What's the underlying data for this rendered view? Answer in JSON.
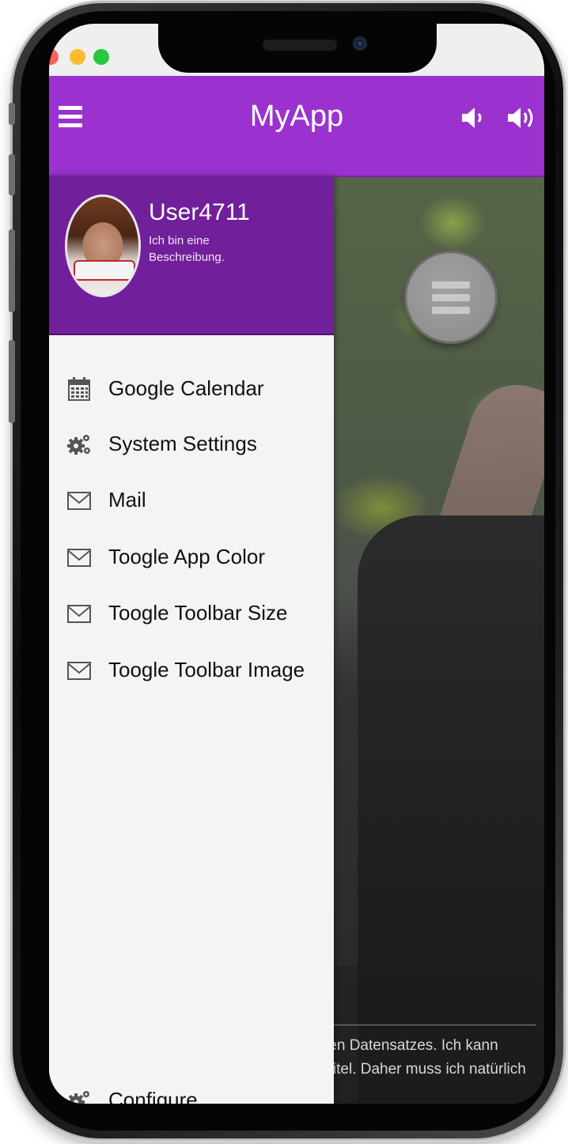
{
  "window_controls": [
    "close",
    "minimize",
    "zoom"
  ],
  "toolbar": {
    "title": "MyApp",
    "menu_icon": "hamburger-icon",
    "actions": [
      {
        "icon": "volume-down-icon"
      },
      {
        "icon": "volume-up-icon"
      }
    ],
    "color": "#9b32cf"
  },
  "drawer": {
    "header": {
      "username": "User4711",
      "description": "Ich bin eine Beschreibung.",
      "color": "#721f9b"
    },
    "items": [
      {
        "label": "Google Calendar",
        "icon": "calendar-icon"
      },
      {
        "label": "System Settings",
        "icon": "gears-icon"
      },
      {
        "label": "Mail",
        "icon": "envelope-icon"
      },
      {
        "label": "Toogle App Color",
        "icon": "envelope-icon"
      },
      {
        "label": "Toogle Toolbar Size",
        "icon": "envelope-icon"
      },
      {
        "label": "Toogle Toolbar Image",
        "icon": "envelope-icon"
      }
    ],
    "footer_item": {
      "label": "Configure",
      "icon": "gears-icon"
    }
  },
  "content": {
    "caption_lines": [
      "ten Datensatzes. Ich kann",
      "Titel. Daher muss ich natürlich"
    ],
    "fab_icon": "menu-fab-icon"
  }
}
